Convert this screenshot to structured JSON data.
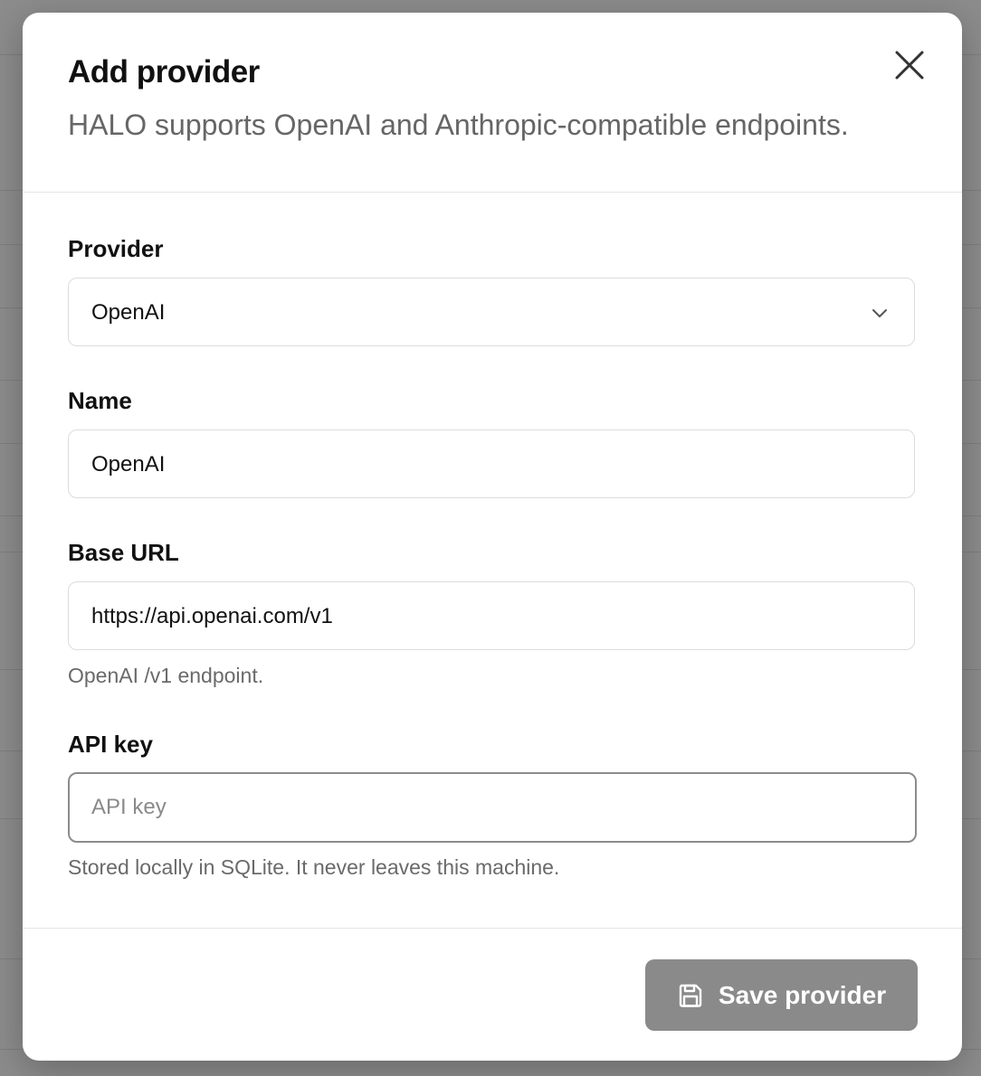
{
  "modal": {
    "title": "Add provider",
    "subtitle": "HALO supports OpenAI and Anthropic-compatible endpoints.",
    "close_icon": "close-icon"
  },
  "fields": {
    "provider": {
      "label": "Provider",
      "selected": "OpenAI",
      "icon": "chevron-down-icon"
    },
    "name": {
      "label": "Name",
      "value": "OpenAI"
    },
    "base_url": {
      "label": "Base URL",
      "value": "https://api.openai.com/v1",
      "helper": "OpenAI /v1 endpoint."
    },
    "api_key": {
      "label": "API key",
      "value": "",
      "placeholder": "API key",
      "helper": "Stored locally in SQLite. It never leaves this machine."
    }
  },
  "footer": {
    "save_label": "Save provider",
    "save_icon": "save-icon"
  },
  "colors": {
    "save_button_bg": "#8a8a8a",
    "overlay": "#000000"
  }
}
